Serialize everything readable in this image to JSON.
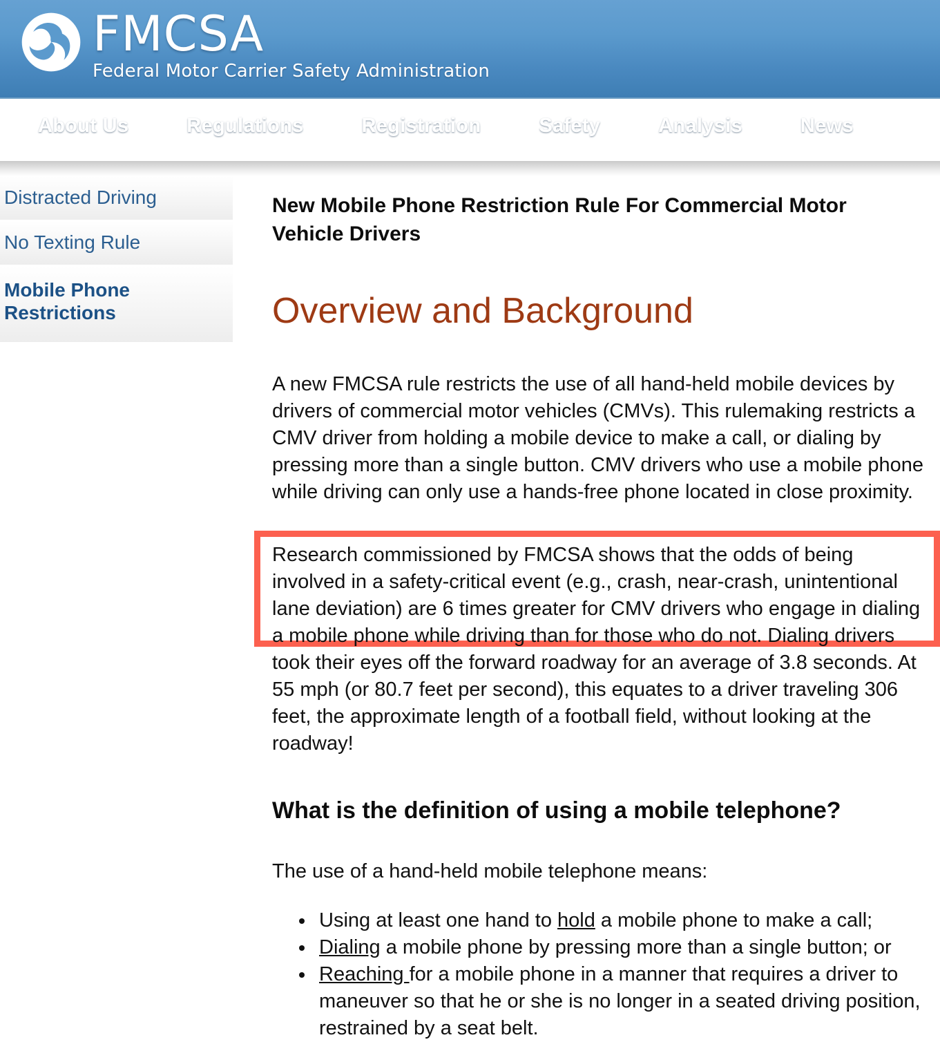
{
  "masthead": {
    "logo_icon": "dot-triskelion-logo",
    "title": "FMCSA",
    "subtitle": "Federal Motor Carrier Safety Administration",
    "background_top": "#66a1d2",
    "background_bottom": "#3e7eb4"
  },
  "nav": {
    "items": [
      {
        "label": "About Us"
      },
      {
        "label": "Regulations"
      },
      {
        "label": "Registration"
      },
      {
        "label": "Safety"
      },
      {
        "label": "Analysis"
      },
      {
        "label": "News"
      }
    ]
  },
  "sidebar": {
    "items": [
      {
        "label": "Distracted Driving",
        "current": false
      },
      {
        "label": "No Texting Rule",
        "current": false
      },
      {
        "label": "Mobile Phone Restrictions",
        "current": true
      }
    ],
    "link_color": "#2b5e90"
  },
  "main": {
    "page_title": "New Mobile Phone Restriction Rule For Commercial Motor Vehicle Drivers",
    "section_heading": "Overview and Background",
    "section_heading_color": "#9e3a14",
    "paragraph_1": "A new FMCSA rule restricts the use of all hand-held mobile devices by drivers of commercial motor vehicles (CMVs). This rulemaking restricts a CMV driver from holding a mobile device to make a call, or dialing by pressing more than a single button. CMV drivers who use a mobile phone while driving can only use a hands-free phone located in close proximity.",
    "paragraph_2": "Research commissioned by FMCSA shows that the odds of being involved in a safety-critical event (e.g., crash, near-crash, unintentional lane deviation) are 6 times greater for CMV drivers who engage in dialing a mobile phone while driving than for those who do not. Dialing drivers took their eyes off the forward roadway for an average of 3.8 seconds. At 55 mph (or 80.7 feet per second), this equates to a driver traveling 306 feet, the approximate length of a football field, without looking at the roadway!",
    "highlight": {
      "color": "#fc604f",
      "border_width_px": 9,
      "covers_text": "Research commissioned by FMCSA shows that the odds of being involved in a safety-critical event (e.g., crash, near-crash, unintentional lane deviation) are 6 times greater for CMV drivers who engage in dialing a mobile phone while driving than for those who do not. Dialing"
    },
    "sub_heading": "What is the definition of using a mobile telephone?",
    "lead_in": "The use of a hand-held mobile telephone means:",
    "definition_list": [
      {
        "underlined": "hold",
        "before": "Using at least one hand to ",
        "after": " a mobile phone to make a call;"
      },
      {
        "underlined": "Dialing",
        "before": "",
        "after": " a mobile phone by pressing more than a single button; or"
      },
      {
        "underlined": "Reaching ",
        "before": "",
        "after": "for a mobile phone in a manner that requires a driver to maneuver so that he or she is no longer in a seated driving position, restrained by a seat belt."
      }
    ]
  }
}
